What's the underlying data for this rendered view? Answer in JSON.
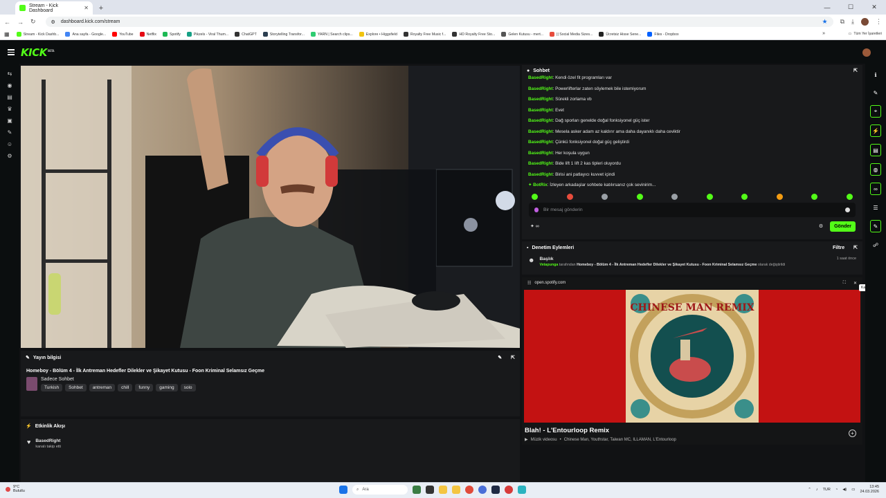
{
  "browser": {
    "tab_title": "Stream - Kick Dashboard",
    "url": "dashboard.kick.com/stream",
    "bookmarks": [
      "Stream - Kick Dashb...",
      "Ana sayfa - Google...",
      "YouTube",
      "Netflix",
      "Spotify",
      "Pikzels - Viral Thum...",
      "ChatGPT",
      "Storytelling Transfor...",
      "YARN | Search clips...",
      "Explore • Higgsfield",
      "Royalty Free Music f...",
      "HD Royalty Free Sto...",
      "Gelen Kutusu - mert...",
      "|| Social Media Sizes...",
      "Ücretsiz Hisse Sene...",
      "Files - Dropbox"
    ],
    "all_bookmarks": "Tüm Yer İşaretleri",
    "bookmark_colors": [
      "#53fc18",
      "#4285f4",
      "#ff0000",
      "#e50914",
      "#1db954",
      "#16a085",
      "#333333",
      "#2c3e50",
      "#2ecc71",
      "#f1c40f",
      "#333333",
      "#333333",
      "#555555",
      "#e74c3c",
      "#222222",
      "#0061ff"
    ]
  },
  "kick": {
    "logo": "KICK",
    "logo_tag": "BETA"
  },
  "stream_info": {
    "header": "Yayın bilgisi",
    "title": "Homeboy - Bölüm 4 - İlk Antreman Hedefler Dilekler ve Şikayet Kutusu - Foon Kriminal Selamsız Geçme",
    "category": "Sadece Sohbet",
    "tags": [
      "Turkish",
      "Sohbet",
      "antreman",
      "chill",
      "funny",
      "gaming",
      "solo"
    ]
  },
  "activity": {
    "header": "Etkinlik Akışı",
    "items": [
      {
        "user": "BasedRight",
        "text": "kanalı takip etti"
      }
    ]
  },
  "chat": {
    "header": "Sohbet",
    "messages": [
      {
        "user": "BasedRight",
        "text": ": Kendi özel fit programları var"
      },
      {
        "user": "BasedRight",
        "text": ": Powerlifterlar zaten söylemek bile istemiyorum"
      },
      {
        "user": "BasedRight",
        "text": ": Sürekli zorlama vb"
      },
      {
        "user": "BasedRight",
        "text": ": Evet"
      },
      {
        "user": "BasedRight",
        "text": ": Dağ sporları genelde doğal fonksiyonel güç ister"
      },
      {
        "user": "BasedRight",
        "text": ": Mesela asker adam az kaldırır ama daha dayanıklı daha ceviktir"
      },
      {
        "user": "BasedRight",
        "text": ": Çünkü fonksiyonel doğal güç geliştirdi"
      },
      {
        "user": "BasedRight",
        "text": ": Her koşula uygun"
      },
      {
        "user": "BasedRight",
        "text": ": Bide lift 1 lift 2 kas tipleri oluyordu"
      },
      {
        "user": "BasedRight",
        "text": ": Birisi ani patlayıcı kuvvet içindi"
      },
      {
        "user": "BotRix",
        "text": ": İzleyen arkadaşlar sohbete katılırsanız çok sevinirim..."
      }
    ],
    "emote_colors": [
      "#53fc18",
      "#e74c3c",
      "#9aa0a6",
      "#53fc18",
      "#9aa0a6",
      "#53fc18",
      "#53fc18",
      "#f39c12",
      "#53fc18",
      "#53fc18"
    ],
    "placeholder": "Bir mesaj gönderin",
    "send": "Gönder"
  },
  "moderation": {
    "header": "Denetim Eylemleri",
    "filter": "Filtre",
    "action": "Başlık",
    "actor": "Vetapunga",
    "actor_suffix": "tarafından",
    "target": "Homeboy - Bölüm 4 - İlk Antreman Hedefler Dilekler ve Şikayet Kutusu - Foon Kriminal Selamsız Geçme",
    "suffix": "olarak değiştirildi",
    "time": "1 saat önce"
  },
  "spotify": {
    "url": "open.spotify.com",
    "title": "Blah! - L'Entourloop Remix",
    "kind": "Müzik videosu",
    "artists": "Chinese Man, Youthstar, Taiwan MC, ILLAMAN, L'Entourloop",
    "tooltip": "Kapat",
    "art_text": "CHINESE MAN REMIX"
  },
  "taskbar": {
    "temp": "9°C",
    "weather": "Bulutlu",
    "search": "Ara",
    "lang": "TUR",
    "time": "13:45",
    "date": "24.03.2026"
  }
}
